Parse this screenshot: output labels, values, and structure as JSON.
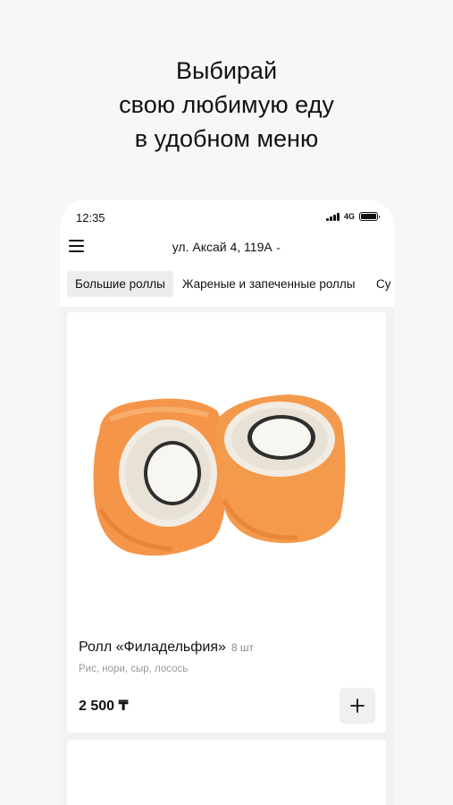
{
  "promo": {
    "line1": "Выбирай",
    "line2": "свою любимую еду",
    "line3": "в удобном меню"
  },
  "status_bar": {
    "time": "12:35",
    "network": "4G",
    "icons": [
      "signal-icon",
      "battery-icon"
    ]
  },
  "header": {
    "menu_icon": "hamburger-menu-icon",
    "address": "ул. Аксай 4, 119А",
    "address_icon": "chevron-down-icon"
  },
  "categories": [
    {
      "label": "Большие роллы",
      "active": true
    },
    {
      "label": "Жареные и запеченные роллы",
      "active": false
    },
    {
      "label": "Су",
      "active": false
    }
  ],
  "products": [
    {
      "name": "Ролл «Филадельфия»",
      "quantity": "8 шт",
      "description": "Рис, нори, сыр, лосось",
      "price": "2 500 ₸",
      "add_icon": "plus-icon"
    }
  ],
  "colors": {
    "background": "#f7f7f7",
    "card": "#ffffff",
    "active_tab": "#ededed",
    "salmon": "#f08a3c"
  }
}
